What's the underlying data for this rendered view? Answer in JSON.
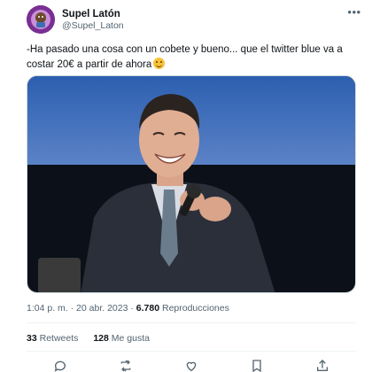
{
  "author": {
    "display_name": "Supel Latón",
    "handle": "@Supel_Laton"
  },
  "more_icon": "more-dots-icon",
  "tweet": {
    "text": "-Ha pasado una cosa con un cobete y bueno... que el twitter blue va a costar 20€ a partir de ahora",
    "emoji": "grinning-sweat-emoji"
  },
  "meta": {
    "time": "1:04 p. m.",
    "separator": " · ",
    "date": "20 abr. 2023",
    "views_count": "6.780",
    "views_label": "Reproducciones"
  },
  "stats": {
    "retweets_count": "33",
    "retweets_label": "Retweets",
    "likes_count": "128",
    "likes_label": "Me gusta"
  },
  "actions": [
    "reply-icon",
    "retweet-icon",
    "like-icon",
    "bookmark-icon",
    "share-icon"
  ],
  "colors": {
    "text_primary": "#0f1419",
    "text_secondary": "#536471",
    "border": "#cfd9de"
  }
}
